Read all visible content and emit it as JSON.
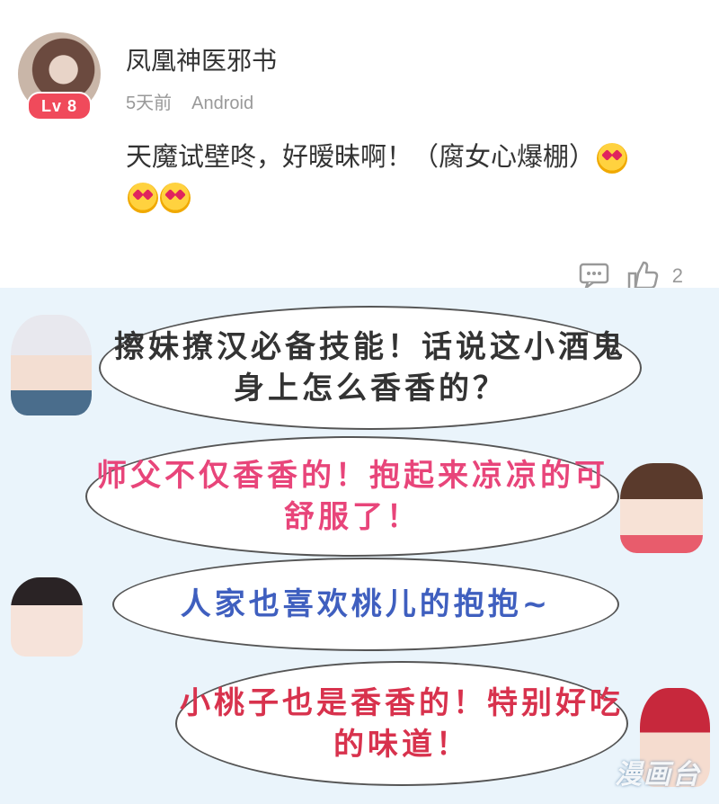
{
  "comment": {
    "username": "凤凰神医邪书",
    "level": "Lv 8",
    "time": "5天前",
    "device": "Android",
    "text": "天魔试壁咚，好暧昧啊！（腐女心爆棚）",
    "emojis": [
      "heart-eyes-emoji",
      "heart-eyes-emoji",
      "heart-eyes-emoji"
    ],
    "likes": "2",
    "icons": [
      "comment-icon",
      "thumbs-up-icon"
    ]
  },
  "comic": {
    "bubbles": [
      "擦妹撩汉必备技能！话说这小酒鬼身上怎么香香的？",
      "师父不仅香香的！抱起来凉凉的可舒服了！",
      "人家也喜欢桃儿的抱抱~",
      "小桃子也是香香的！特别好吃的味道！"
    ],
    "watermark": "漫画台"
  },
  "colors": {
    "bubble1": "#333333",
    "bubble2": "#e8457a",
    "bubble3": "#3f5fbf",
    "bubble4": "#d8324d",
    "level_badge": "#f04a5b"
  }
}
